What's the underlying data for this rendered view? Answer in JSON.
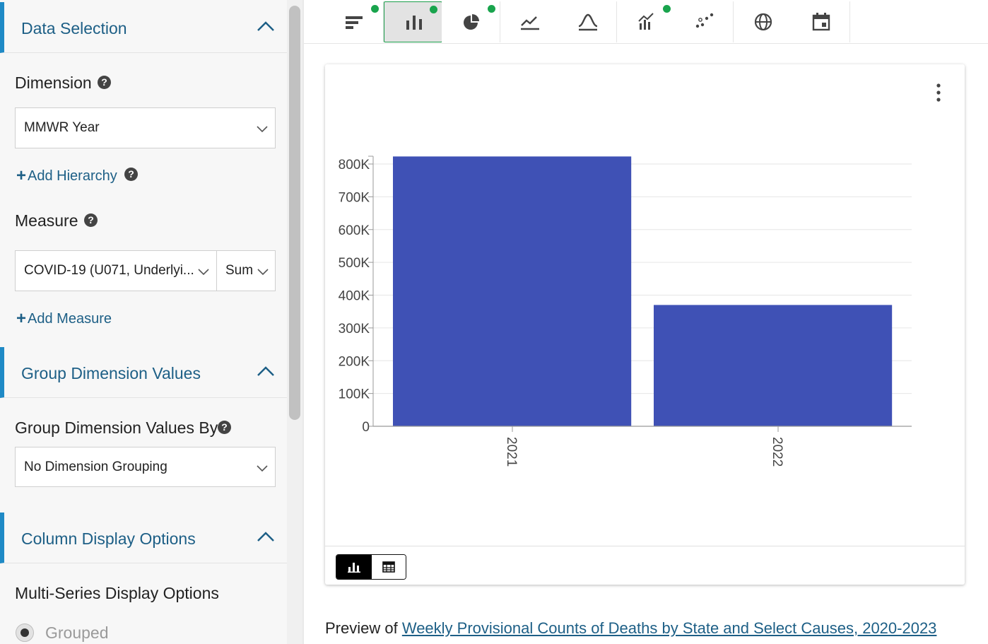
{
  "left_panel": {
    "data_selection": {
      "title": "Data Selection",
      "dimension_label": "Dimension",
      "dimension_value": "MMWR Year",
      "add_hierarchy": "Add Hierarchy",
      "measure_label": "Measure",
      "measure_value": "COVID-19 (U071, Underlyi...",
      "aggregate_value": "Sum",
      "add_measure": "Add Measure"
    },
    "group_dimension": {
      "title": "Group Dimension Values",
      "label": "Group Dimension Values By",
      "value": "No Dimension Grouping"
    },
    "column_display": {
      "title": "Column Display Options",
      "multi_series_label": "Multi-Series Display Options",
      "option_grouped": "Grouped"
    }
  },
  "toolbar": {
    "tools": [
      {
        "icon": "horizontal-bar-chart-icon",
        "active": false,
        "has_dot": true
      },
      {
        "icon": "vertical-bar-chart-icon",
        "active": true,
        "has_dot": true
      },
      {
        "icon": "pie-chart-icon",
        "active": false,
        "has_dot": true
      },
      {
        "icon": "line-chart-icon",
        "active": false,
        "has_dot": false
      },
      {
        "icon": "distribution-curve-icon",
        "active": false,
        "has_dot": false
      },
      {
        "icon": "combo-chart-icon",
        "active": false,
        "has_dot": true
      },
      {
        "icon": "scatter-plot-icon",
        "active": false,
        "has_dot": false
      },
      {
        "icon": "globe-map-icon",
        "active": false,
        "has_dot": false
      },
      {
        "icon": "calendar-icon",
        "active": false,
        "has_dot": false
      }
    ],
    "dot_color": "#19a44d"
  },
  "chart_data": {
    "type": "bar",
    "categories": [
      "2021",
      "2022"
    ],
    "values": [
      823000,
      370000
    ],
    "ylim": [
      0,
      820000
    ],
    "yticks": [
      0,
      100000,
      200000,
      300000,
      400000,
      500000,
      600000,
      700000,
      800000
    ],
    "ytick_labels": [
      "0",
      "100K",
      "200K",
      "300K",
      "400K",
      "500K",
      "600K",
      "700K",
      "800K"
    ],
    "bar_color": "#3f51b5",
    "grid": true,
    "title": "",
    "xlabel": "",
    "ylabel": ""
  },
  "preview": {
    "prefix": "Preview of ",
    "link_text": "Weekly Provisional Counts of Deaths by State and Select Causes, 2020-2023"
  }
}
